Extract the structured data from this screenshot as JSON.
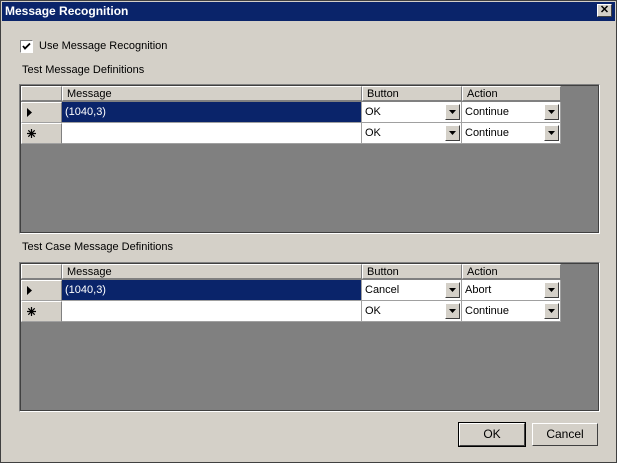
{
  "window": {
    "title": "Message Recognition",
    "close_glyph": "✕"
  },
  "use_recognition": {
    "label": "Use Message Recognition",
    "checked": true
  },
  "test_messages": {
    "label": "Test Message Definitions",
    "headers": {
      "message": "Message",
      "button": "Button",
      "action": "Action"
    },
    "rows": [
      {
        "message": "(1040,3)",
        "button": "OK",
        "action": "Continue",
        "indicator": "current",
        "selected": true
      },
      {
        "message": "",
        "button": "OK",
        "action": "Continue",
        "indicator": "new",
        "selected": false
      }
    ]
  },
  "test_case_messages": {
    "label": "Test Case Message Definitions",
    "headers": {
      "message": "Message",
      "button": "Button",
      "action": "Action"
    },
    "rows": [
      {
        "message": "(1040,3)",
        "button": "Cancel",
        "action": "Abort",
        "indicator": "current",
        "selected": true
      },
      {
        "message": "",
        "button": "OK",
        "action": "Continue",
        "indicator": "new",
        "selected": false
      }
    ]
  },
  "buttons": {
    "ok": "OK",
    "cancel": "Cancel"
  },
  "colors": {
    "titlebar": "#0a246a",
    "face": "#d4d0c8",
    "selection": "#0a246a",
    "grid_bg": "#808080"
  }
}
